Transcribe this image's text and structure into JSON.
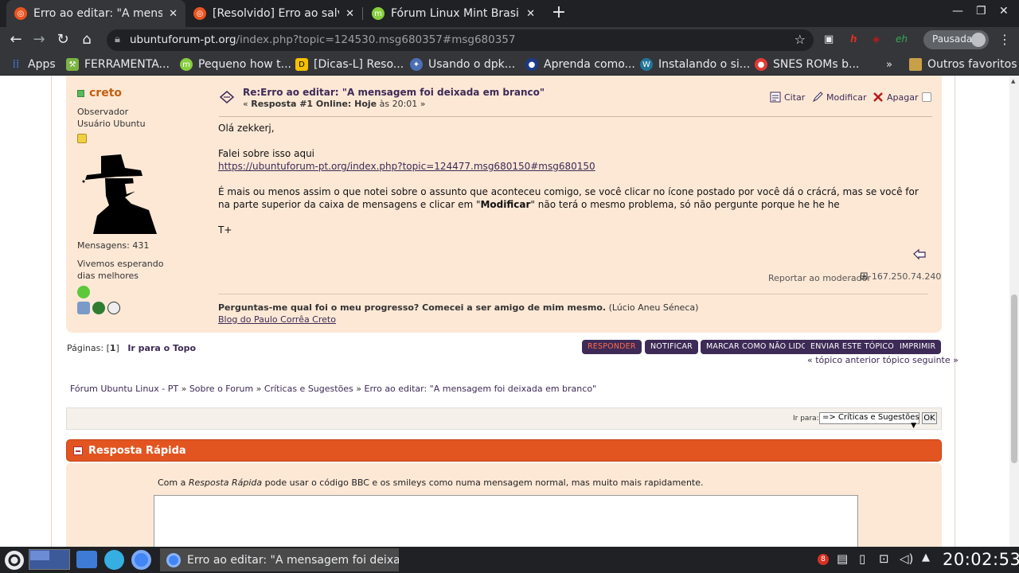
{
  "browser": {
    "tabs": [
      {
        "title": "Erro ao editar: \"A mensagem foi deixada em branco\"",
        "favicon_color": "#e95420",
        "active": true
      },
      {
        "title": "[Resolvido] Erro ao salvar",
        "favicon_color": "#e95420",
        "active": false
      },
      {
        "title": "Fórum Linux Mint Brasil",
        "favicon_color": "#87cf3e",
        "active": false
      }
    ],
    "url_host": "ubuntuforum-pt.org",
    "url_path": "/index.php?topic=124530.msg680357#msg680357",
    "profile_label": "Pausada",
    "bookmarks": [
      {
        "label": "Apps",
        "icon": "apps-grid-icon",
        "color": "#4285f4"
      },
      {
        "label": "FERRAMENTA...",
        "icon": "tools-icon",
        "color": "#7cb342"
      },
      {
        "label": "Pequeno how t...",
        "icon": "mint-icon",
        "color": "#87cf3e"
      },
      {
        "label": "[Dicas-L] Reso...",
        "icon": "dicas-icon",
        "color": "#f6c000"
      },
      {
        "label": "Usando o dpk...",
        "icon": "debian-icon",
        "color": "#4a6fb5"
      },
      {
        "label": "Aprenda como...",
        "icon": "person-icon",
        "color": "#1a3a8a"
      },
      {
        "label": "Instalando o si...",
        "icon": "wordpress-icon",
        "color": "#21759b"
      },
      {
        "label": "SNES ROMs b...",
        "icon": "mushroom-icon",
        "color": "#e53935"
      }
    ],
    "other_bookmarks": "Outros favoritos"
  },
  "post": {
    "poster_name": "creto",
    "poster_group": "Observador",
    "poster_title": "Usuário Ubuntu",
    "messages": "Mensagens: 431",
    "personal_text": "Vivemos esperando dias melhores",
    "title": "Re:Erro ao editar: \"A mensagem foi deixada em branco\"",
    "meta_open": "« ",
    "meta_bold": "Resposta #1 Online: Hoje",
    "meta_rest": " às 20:01 »",
    "actions": {
      "quote": "Citar",
      "modify": "Modificar",
      "delete": "Apagar"
    },
    "body_greeting": "Olá zekkerj,",
    "body_line2": "Falei sobre isso aqui",
    "body_link": "https://ubuntuforum-pt.org/index.php?topic=124477.msg680150#msg680150",
    "body_p3_a": "É mais ou menos assim o que notei sobre o assunto que aconteceu comigo, se você clicar no ícone postado por você dá o crácrá, mas se você for na parte superior da caixa de mensagens e clicar em \"",
    "body_p3_bold": "Modificar",
    "body_p3_b": "\" não terá o mesmo problema, só não pergunte porque he he he",
    "body_signoff": "T+",
    "report": "Reportar ao moderador",
    "ip": "167.250.74.240",
    "signature_bold": "Perguntas-me qual foi o meu progresso? Comecei a ser amigo de mim mesmo.",
    "signature_rest": " (Lúcio Aneu Séneca)",
    "signature_link": "Blog do Paulo Corrêa Creto"
  },
  "pagination": {
    "label": "Páginas: [",
    "current": "1",
    "close": "]",
    "top_link": "Ir para o Topo"
  },
  "buttons": {
    "reply": "RESPONDER",
    "notify": "NOTIFICAR",
    "mark_unread": "MARCAR COMO NÃO LIDO",
    "send_topic": "ENVIAR ESTE TÓPICO",
    "print": "IMPRIMIR"
  },
  "topic_nav": "« tópico anterior tópico seguinte »",
  "breadcrumb": [
    "Fórum Ubuntu Linux - PT",
    "Sobre o Forum",
    "Críticas e Sugestões",
    "Erro ao editar: \"A mensagem foi deixada em branco\""
  ],
  "jump": {
    "label": "Ir para:",
    "value": "=> Críticas e Sugestões",
    "ok": "OK"
  },
  "quick_reply": {
    "title": "Resposta Rápida",
    "text_a": "Com a ",
    "text_italic": "Resposta Rápida",
    "text_b": " pode usar o código BBC e os smileys como numa mensagem normal, mas muito mais rapidamente."
  },
  "taskbar": {
    "window_title": "Erro ao editar: \"A mensagem foi deixada...",
    "clock": "20:02:53",
    "notif_count": "8"
  },
  "colors": {
    "accent": "#e25521",
    "link": "#3d2a56",
    "post_bg": "#fde8d6"
  }
}
